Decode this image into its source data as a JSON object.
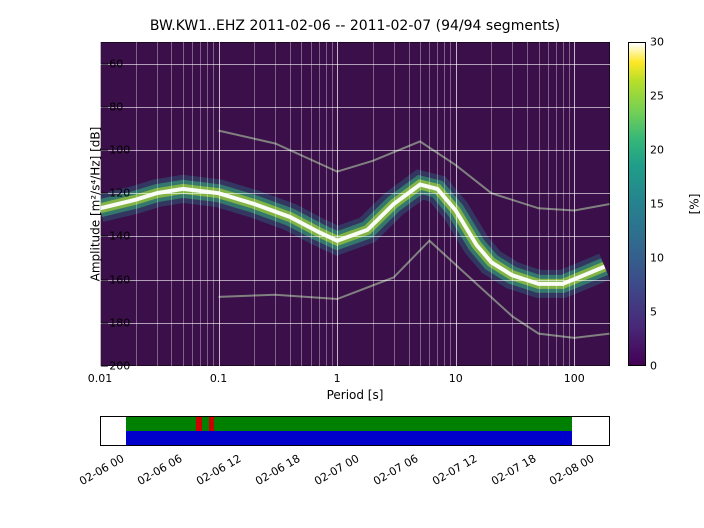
{
  "title": "BW.KW1..EHZ    2011-02-06 -- 2011-02-07  (94/94 segments)",
  "ylabel": "Amplitude [m²/s⁴/Hz] [dB]",
  "xlabel": "Period [s]",
  "cblabel": "[%]",
  "colorbar_ticks": [
    "0",
    "5",
    "10",
    "15",
    "20",
    "25",
    "30"
  ],
  "y_ticks": [
    "-60",
    "-80",
    "-100",
    "-120",
    "-140",
    "-160",
    "-180",
    "-200"
  ],
  "x_ticks_major": [
    "0.01",
    "0.1",
    "1",
    "10",
    "100"
  ],
  "time_ticks": [
    "02-06 00",
    "02-06 06",
    "02-06 12",
    "02-06 18",
    "02-07 00",
    "02-07 06",
    "02-07 12",
    "02-07 18",
    "02-08 00"
  ],
  "chart_data": {
    "type": "heatmap",
    "title": "BW.KW1..EHZ PPSD",
    "xlabel": "Period [s]",
    "ylabel": "Amplitude [m²/s⁴/Hz] [dB]",
    "x_scale": "log",
    "xlim": [
      0.01,
      200
    ],
    "ylim": [
      -200,
      -50
    ],
    "colorbar_range": [
      0,
      30
    ],
    "colorbar_label": "[%]",
    "segments": "94/94",
    "date_range": [
      "2011-02-06",
      "2011-02-07"
    ],
    "psd_mode_curve": [
      {
        "period": 0.01,
        "db": -127
      },
      {
        "period": 0.02,
        "db": -123
      },
      {
        "period": 0.03,
        "db": -120
      },
      {
        "period": 0.05,
        "db": -118
      },
      {
        "period": 0.1,
        "db": -120
      },
      {
        "period": 0.2,
        "db": -125
      },
      {
        "period": 0.4,
        "db": -131
      },
      {
        "period": 0.7,
        "db": -138
      },
      {
        "period": 1.0,
        "db": -142
      },
      {
        "period": 1.8,
        "db": -137
      },
      {
        "period": 3.0,
        "db": -125
      },
      {
        "period": 5.0,
        "db": -116
      },
      {
        "period": 7.0,
        "db": -118
      },
      {
        "period": 10.0,
        "db": -128
      },
      {
        "period": 15.0,
        "db": -144
      },
      {
        "period": 20.0,
        "db": -152
      },
      {
        "period": 30.0,
        "db": -158
      },
      {
        "period": 50.0,
        "db": -162
      },
      {
        "period": 80.0,
        "db": -162
      },
      {
        "period": 120.0,
        "db": -158
      },
      {
        "period": 180.0,
        "db": -154
      }
    ],
    "noise_high_curve": [
      {
        "period": 0.1,
        "db": -91
      },
      {
        "period": 0.3,
        "db": -97
      },
      {
        "period": 1.0,
        "db": -110
      },
      {
        "period": 2.0,
        "db": -105
      },
      {
        "period": 5.0,
        "db": -96
      },
      {
        "period": 10.0,
        "db": -107
      },
      {
        "period": 20.0,
        "db": -120
      },
      {
        "period": 50.0,
        "db": -127
      },
      {
        "period": 100.0,
        "db": -128
      },
      {
        "period": 200.0,
        "db": -125
      }
    ],
    "noise_low_curve": [
      {
        "period": 0.1,
        "db": -168
      },
      {
        "period": 0.3,
        "db": -167
      },
      {
        "period": 1.0,
        "db": -169
      },
      {
        "period": 3.0,
        "db": -159
      },
      {
        "period": 6.0,
        "db": -142
      },
      {
        "period": 15.0,
        "db": -162
      },
      {
        "period": 30.0,
        "db": -177
      },
      {
        "period": 50.0,
        "db": -185
      },
      {
        "period": 100.0,
        "db": -187
      },
      {
        "period": 200.0,
        "db": -185
      }
    ],
    "timeline": {
      "range_start": "2011-02-05 22:00",
      "range_end": "2011-02-08 02:00",
      "green_bar": {
        "start": "2011-02-06 00:30",
        "end": "2011-02-07 22:00"
      },
      "blue_bar": {
        "start": "2011-02-06 00:30",
        "end": "2011-02-07 22:00"
      },
      "red_marks": [
        {
          "start": "2011-02-06 07:40",
          "end": "2011-02-06 08:20"
        },
        {
          "start": "2011-02-06 09:00",
          "end": "2011-02-06 09:30"
        }
      ]
    }
  }
}
